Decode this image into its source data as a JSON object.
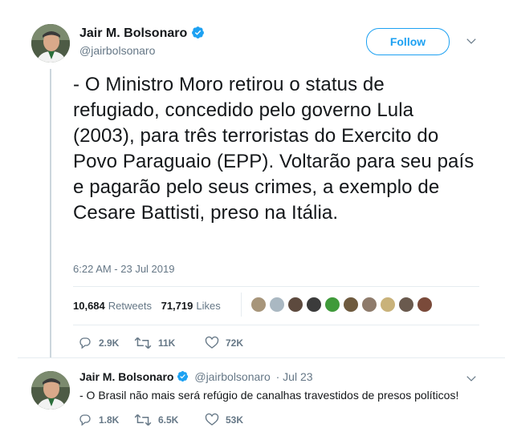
{
  "main_tweet": {
    "author_name": "Jair M. Bolsonaro",
    "author_handle": "@jairbolsonaro",
    "follow_label": "Follow",
    "text": "- O Ministro Moro retirou o status de refugiado, concedido pelo governo Lula (2003), para três terroristas do Exercito do Povo Paraguaio (EPP). Voltarão para seu país e pagarão pelo seus crimes, a exemplo de Cesare Battisti, preso na Itália.",
    "timestamp": "6:22 AM - 23 Jul 2019",
    "retweets_count": "10,684",
    "retweets_label": "Retweets",
    "likes_count": "71,719",
    "likes_label": "Likes",
    "replies": "2.9K",
    "retweets_short": "11K",
    "likes_short": "72K"
  },
  "reply_tweet": {
    "author_name": "Jair M. Bolsonaro",
    "author_handle": "@jairbolsonaro",
    "date": "· Jul 23",
    "text": "- O Brasil não mais será refúgio de canalhas travestidos de presos políticos!",
    "replies": "1.8K",
    "retweets": "6.5K",
    "likes": "53K"
  },
  "colors": {
    "accent": "#1da1f2",
    "secondary_text": "#657786",
    "divider": "#e6ecf0"
  },
  "icons": [
    "verified-badge-icon",
    "chevron-down-icon",
    "reply-icon",
    "retweet-icon",
    "like-icon"
  ]
}
